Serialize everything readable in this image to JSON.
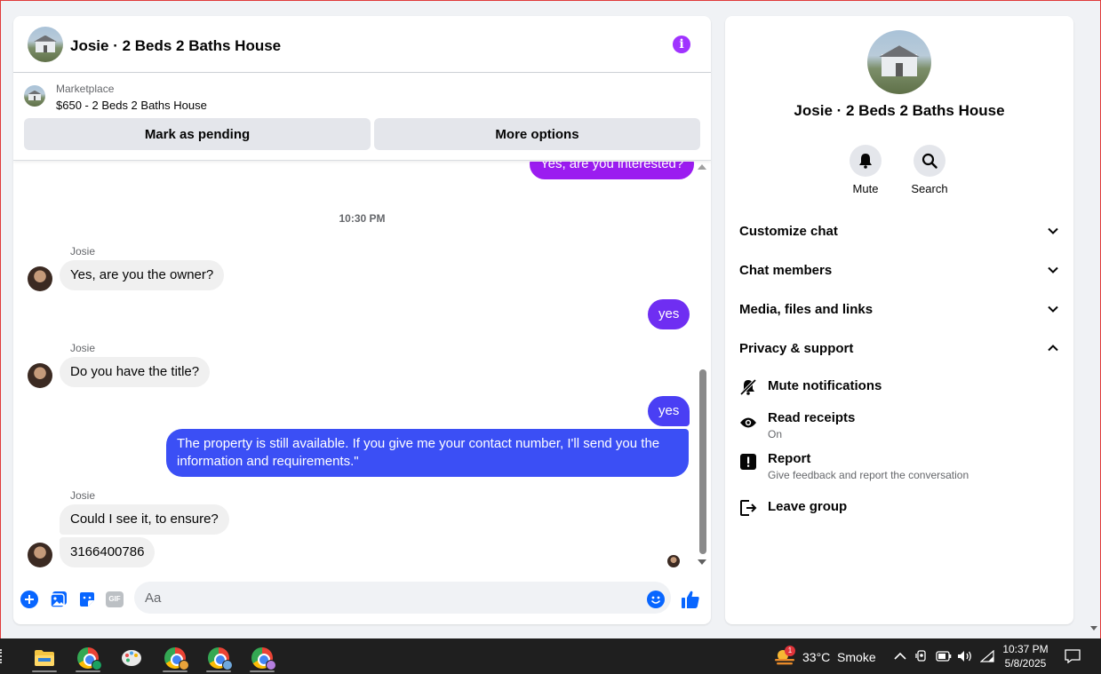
{
  "header": {
    "title": "Josie · 2 Beds 2 Baths House"
  },
  "marketplace": {
    "label": "Marketplace",
    "listing": "$650 - 2 Beds 2 Baths House",
    "mark_pending": "Mark as pending",
    "more_options": "More options"
  },
  "messages": {
    "partial_out": "Yes, are you interested?",
    "timestamp": "10:30 PM",
    "sender": "Josie",
    "m1": "Yes, are you the owner?",
    "m2": "yes",
    "m3": "Do you have the title?",
    "m4": "yes",
    "m5_line1": "The property is still available. If you give me your contact number, I'll send you the",
    "m5_line2": "information and requirements.\"",
    "m6": "Could I see it, to ensure?",
    "m7": "3166400786"
  },
  "composer": {
    "placeholder": "Aa",
    "gif": "GIF"
  },
  "side": {
    "title": "Josie · 2 Beds 2 Baths House",
    "mute": "Mute",
    "search": "Search",
    "sections": {
      "customize": "Customize chat",
      "members": "Chat members",
      "media": "Media, files and links",
      "privacy": "Privacy & support"
    },
    "options": {
      "mute_notifications": "Mute notifications",
      "read_receipts": "Read receipts",
      "read_receipts_state": "On",
      "report": "Report",
      "report_sub": "Give feedback and report the conversation",
      "leave": "Leave group"
    }
  },
  "taskbar": {
    "weather_badge": "1",
    "weather": "33°C  Smoke",
    "time": "10:37 PM",
    "date": "5/8/2025"
  },
  "colors": {
    "accent": "#a033ff",
    "bubble_out_top": "#9b1cf0",
    "bubble_out_mid": "#6f2ef2",
    "bubble_out_bottom": "#3b4ff5",
    "incoming": "#f0f0f0",
    "icon_blue": "#0866ff"
  }
}
